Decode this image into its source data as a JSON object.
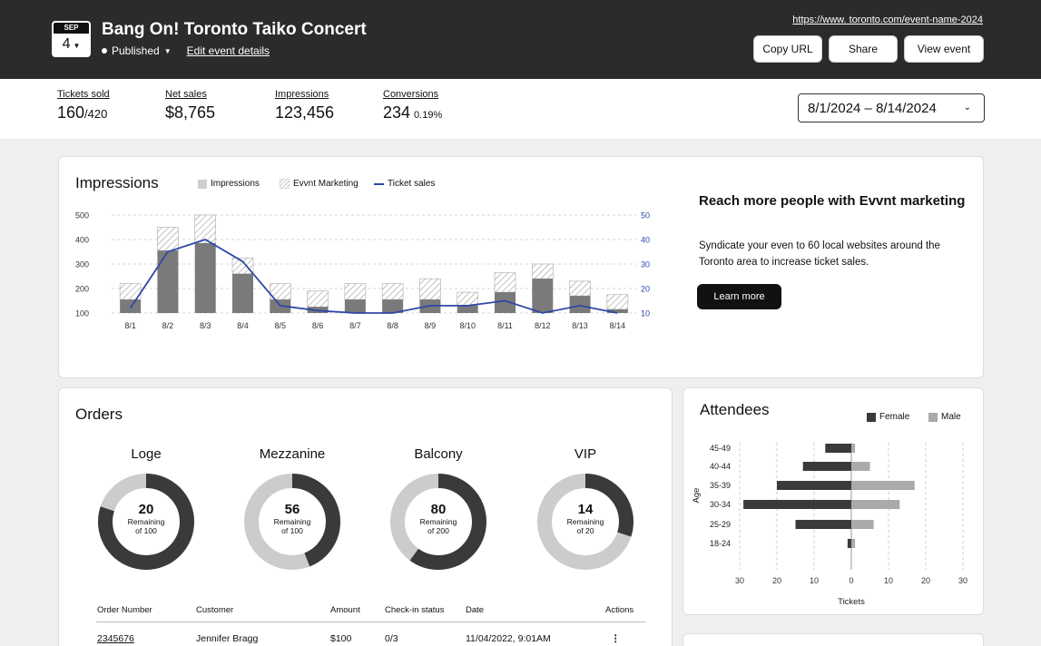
{
  "header": {
    "calendar_month": "SEP",
    "calendar_day": "4",
    "event_title": "Bang On! Toronto Taiko Concert",
    "status": "Published",
    "edit_link": "Edit event details",
    "event_url": "https://www. toronto.com/event-name-2024",
    "buttons": {
      "copy_url": "Copy URL",
      "share": "Share",
      "view_event": "View event"
    }
  },
  "stats": {
    "tickets_sold": {
      "label": "Tickets sold",
      "value": "160",
      "total": "/420"
    },
    "net_sales": {
      "label": "Net sales",
      "value": "$8,765"
    },
    "impressions": {
      "label": "Impressions",
      "value": "123,456"
    },
    "conversions": {
      "label": "Conversions",
      "value": "234",
      "percent": "0.19%"
    },
    "date_range": "8/1/2024 – 8/14/2024"
  },
  "impressions_card": {
    "title": "Impressions",
    "legend": {
      "impressions": "Impressions",
      "marketing": "Evvnt Marketing",
      "ticket_sales": "Ticket sales"
    },
    "promo_title": "Reach more people with Evvnt marketing",
    "promo_text": "Syndicate your even to 60 local websites around the Toronto area to increase ticket sales.",
    "learn_more": "Learn more"
  },
  "colors": {
    "header_bg": "#2b2b2b",
    "line_blue": "#2f47a8",
    "bar_gray": "#7a7a7a",
    "female": "#3a3a3a",
    "male": "#aaaaaa",
    "donut_dark": "#3a3a3a",
    "donut_light": "#cccccc"
  },
  "chart_data": [
    {
      "type": "bar",
      "categories": [
        "8/1",
        "8/2",
        "8/3",
        "8/4",
        "8/5",
        "8/6",
        "8/7",
        "8/8",
        "8/9",
        "8/10",
        "8/11",
        "8/12",
        "8/13",
        "8/14"
      ],
      "series": [
        {
          "name": "Impressions",
          "values": [
            155,
            355,
            385,
            260,
            155,
            125,
            155,
            155,
            155,
            130,
            185,
            240,
            170,
            115
          ]
        },
        {
          "name": "Evvnt Marketing",
          "values": [
            65,
            95,
            115,
            65,
            65,
            65,
            65,
            65,
            85,
            55,
            80,
            60,
            60,
            60
          ]
        },
        {
          "name": "Ticket sales",
          "axis": "right",
          "values": [
            12,
            35,
            40,
            31,
            13,
            11,
            10,
            10,
            13,
            13,
            15,
            10,
            13,
            10
          ]
        }
      ],
      "ylim": [
        100,
        500
      ],
      "y2lim": [
        10,
        50
      ],
      "yticks": [
        100,
        200,
        300,
        400,
        500
      ],
      "y2ticks": [
        10,
        20,
        30,
        40,
        50
      ],
      "grid": true
    },
    {
      "type": "bar",
      "orientation": "horizontal",
      "title": "Attendees",
      "categories": [
        "45-49",
        "40-44",
        "35-39",
        "30-34",
        "25-29",
        "18-24"
      ],
      "series": [
        {
          "name": "Female",
          "values": [
            7,
            13,
            20,
            29,
            15,
            1
          ]
        },
        {
          "name": "Male",
          "values": [
            1,
            5,
            17,
            13,
            6,
            1
          ]
        }
      ],
      "xlabel": "Tickets",
      "ylabel": "Age",
      "xticks": [
        "30",
        "20",
        "10",
        "0",
        "10",
        "20",
        "30"
      ],
      "legend": "top-right"
    },
    {
      "type": "pie",
      "title": "Orders",
      "donuts": [
        {
          "label": "Loge",
          "value": "20",
          "remaining": "Remaining",
          "of": "of 100",
          "fraction": 0.8
        },
        {
          "label": "Mezzanine",
          "value": "56",
          "remaining": "Remaining",
          "of": "of 100",
          "fraction": 0.44
        },
        {
          "label": "Balcony",
          "value": "80",
          "remaining": "Remaining",
          "of": "of 200",
          "fraction": 0.6
        },
        {
          "label": "VIP",
          "value": "14",
          "remaining": "Remaining",
          "of": "of 20",
          "fraction": 0.3
        }
      ]
    }
  ],
  "orders": {
    "title": "Orders",
    "columns": [
      "Order Number",
      "Customer",
      "Amount",
      "Check-in status",
      "Date",
      "Actions"
    ],
    "rows": [
      {
        "order": "2345676",
        "customer": "Jennifer Bragg",
        "amount": "$100",
        "checkin": "0/3",
        "date": "11/04/2022, 9:01AM",
        "actions": "⋮"
      }
    ]
  },
  "attendees": {
    "title": "Attendees",
    "legend_female": "Female",
    "legend_male": "Male",
    "ylabel": "Age",
    "xlabel": "Tickets"
  }
}
